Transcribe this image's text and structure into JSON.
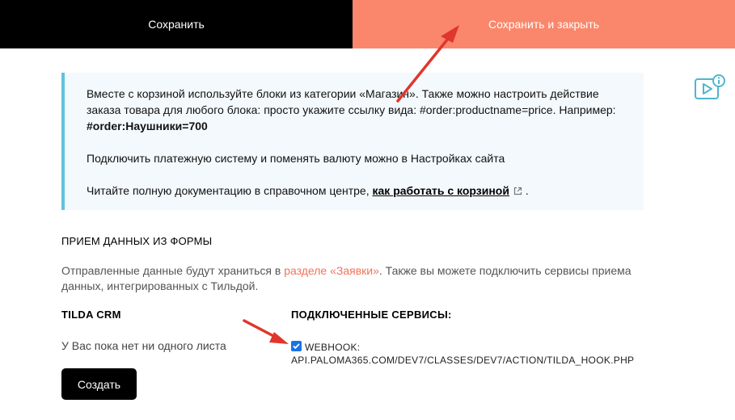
{
  "colors": {
    "save_bg": "#000000",
    "save_close_bg": "#fa876b",
    "info_border": "#60c2de",
    "info_bg": "#f4f9fd",
    "link_accent": "#f1735a",
    "annotation_arrow": "#e0362b"
  },
  "topbar": {
    "save_label": "Сохранить",
    "save_close_label": "Сохранить и закрыть"
  },
  "help": {
    "icon": "video-info-icon"
  },
  "info": {
    "para1_text": "Вместе с корзиной используйте блоки из категории «Магазин». Также можно настроить действие заказа товара для любого блока: просто укажите ссылку вида: #order:productname=price. Например: ",
    "para1_code": "#order:Наушники=700",
    "para2": "Подключить платежную систему и поменять валюту можно в Настройках сайта",
    "para3_prefix": "Читайте полную документацию в справочном центре, ",
    "para3_link": "как работать с корзиной",
    "para3_suffix": " ."
  },
  "form_section": {
    "title": "ПРИЕМ ДАННЫХ ИЗ ФОРМЫ",
    "desc_prefix": "Отправленные данные будут храниться в ",
    "desc_link": "разделе «Заявки»",
    "desc_suffix": ". Также вы можете подключить сервисы приема данных, интегрированных с Тильдой."
  },
  "crm": {
    "title": "TILDA CRM",
    "empty_text": "У Вас пока нет ни одного листа",
    "create_label": "Создать"
  },
  "services": {
    "title": "ПОДКЛЮЧЕННЫЕ СЕРВИСЫ:",
    "webhook_label": "WEBHOOK:",
    "webhook_url": "API.PALOMA365.COM/DEV7/CLASSES/DEV7/ACTION/TILDA_HOOK.PHP",
    "webhook_checked": true
  }
}
